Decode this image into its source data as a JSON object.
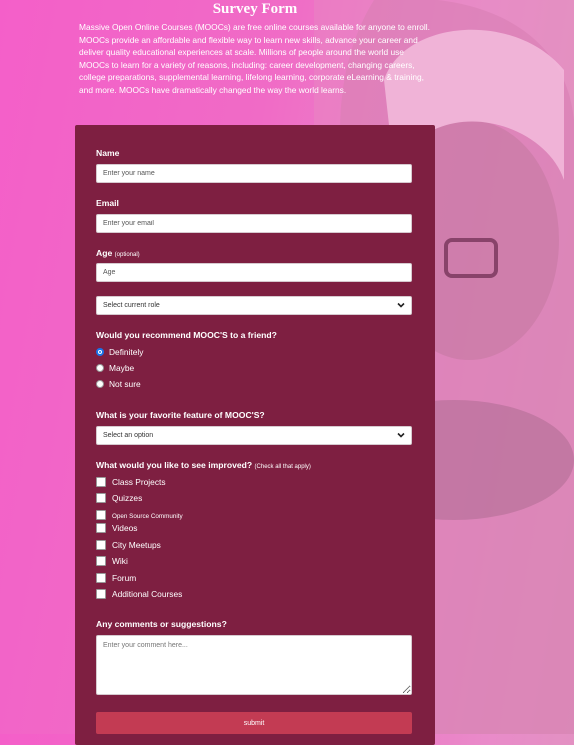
{
  "page": {
    "title": "Survey Form",
    "intro": "Massive Open Online Courses (MOOCs) are free online courses available for anyone to enroll. MOOCs provide an affordable and flexible way to learn new skills, advance your career and deliver quality educational experiences at scale. Millions of people around the world use MOOCs to learn for a variety of reasons, including: career development, changing careers, college preparations, supplemental learning, lifelong learning, corporate eLearning & training, and more. MOOCs have dramatically changed the way the world learns."
  },
  "form": {
    "name": {
      "label": "Name",
      "placeholder": "Enter your name"
    },
    "email": {
      "label": "Email",
      "placeholder": "Enter your email"
    },
    "age": {
      "label": "Age",
      "hint": "(optional)",
      "placeholder": "Age"
    },
    "role": {
      "selected": "Select current role"
    },
    "recommend": {
      "question": "Would you recommend MOOC'S to a friend?",
      "options": [
        "Definitely",
        "Maybe",
        "Not sure"
      ],
      "selected": "Definitely"
    },
    "feature": {
      "question": "What is your favorite feature of MOOC'S?",
      "selected": "Select an option"
    },
    "improve": {
      "question": "What would you like to see improved?",
      "hint": "(Check all that apply)",
      "options": [
        "Class Projects",
        "Quizzes",
        "Open Source Community",
        "Videos",
        "City Meetups",
        "Wiki",
        "Forum",
        "Additional Courses"
      ]
    },
    "comments": {
      "label": "Any comments or suggestions?",
      "placeholder": "Enter your comment here..."
    },
    "submit_label": "submit"
  },
  "icons": {
    "select_arrow": "chevron-down-icon",
    "resize": "resize-grip-icon"
  },
  "colors": {
    "card": "#7e1f41",
    "submit": "#c33b53",
    "radio_selected": "#1a73e8"
  }
}
